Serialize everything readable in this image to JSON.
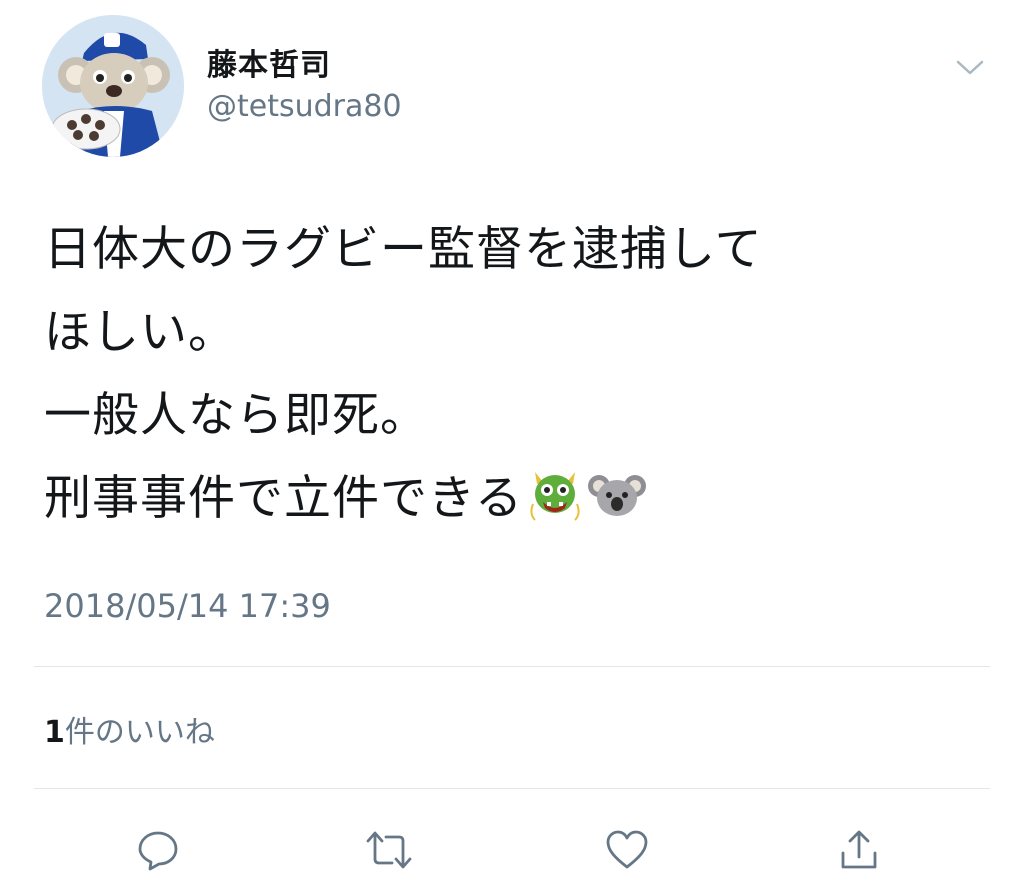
{
  "tweet": {
    "author": {
      "display_name": "藤本哲司",
      "handle": "@tetsudra80",
      "avatar_icon": "mascot-avatar"
    },
    "text_lines": [
      "日体大のラグビー監督を逮捕して",
      "ほしい。",
      "一般人なら即死。",
      "刑事事件で立件できる"
    ],
    "emojis": [
      "dragon-face-icon",
      "koala-icon"
    ],
    "timestamp": "2018/05/14 17:39",
    "likes": {
      "count": "1",
      "label": "件のいいね"
    },
    "actions": [
      "reply",
      "retweet",
      "like",
      "share"
    ]
  },
  "colors": {
    "text": "#14171a",
    "secondary": "#657786",
    "divider": "#e1e8ed",
    "icon": "#657786"
  }
}
